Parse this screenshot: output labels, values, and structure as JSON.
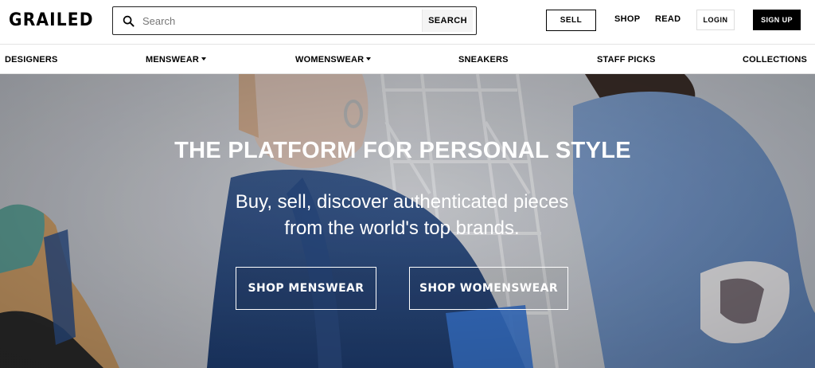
{
  "header": {
    "logo": "GRAILED",
    "search": {
      "placeholder": "Search",
      "button_label": "SEARCH"
    },
    "sell_label": "SELL",
    "shop_label": "SHOP",
    "read_label": "READ",
    "login_label": "LOGIN",
    "signup_label": "SIGN UP"
  },
  "categories": [
    {
      "label": "DESIGNERS"
    },
    {
      "label": "MENSWEAR"
    },
    {
      "label": "WOMENSWEAR"
    },
    {
      "label": "SNEAKERS"
    },
    {
      "label": "STAFF PICKS"
    },
    {
      "label": "COLLECTIONS"
    }
  ],
  "hero": {
    "title": "THE PLATFORM FOR PERSONAL STYLE",
    "subtitle_line1": "Buy, sell, discover authenticated pieces",
    "subtitle_line2": "from the world's top brands.",
    "shop_menswear_label": "SHOP MENSWEAR",
    "shop_womenswear_label": "SHOP WOMENSWEAR"
  },
  "icons": {
    "search": "search-icon",
    "dropdown": "caret-down-icon"
  },
  "colors": {
    "accent": "#000000",
    "background": "#ffffff",
    "hero_text": "#ffffff"
  }
}
